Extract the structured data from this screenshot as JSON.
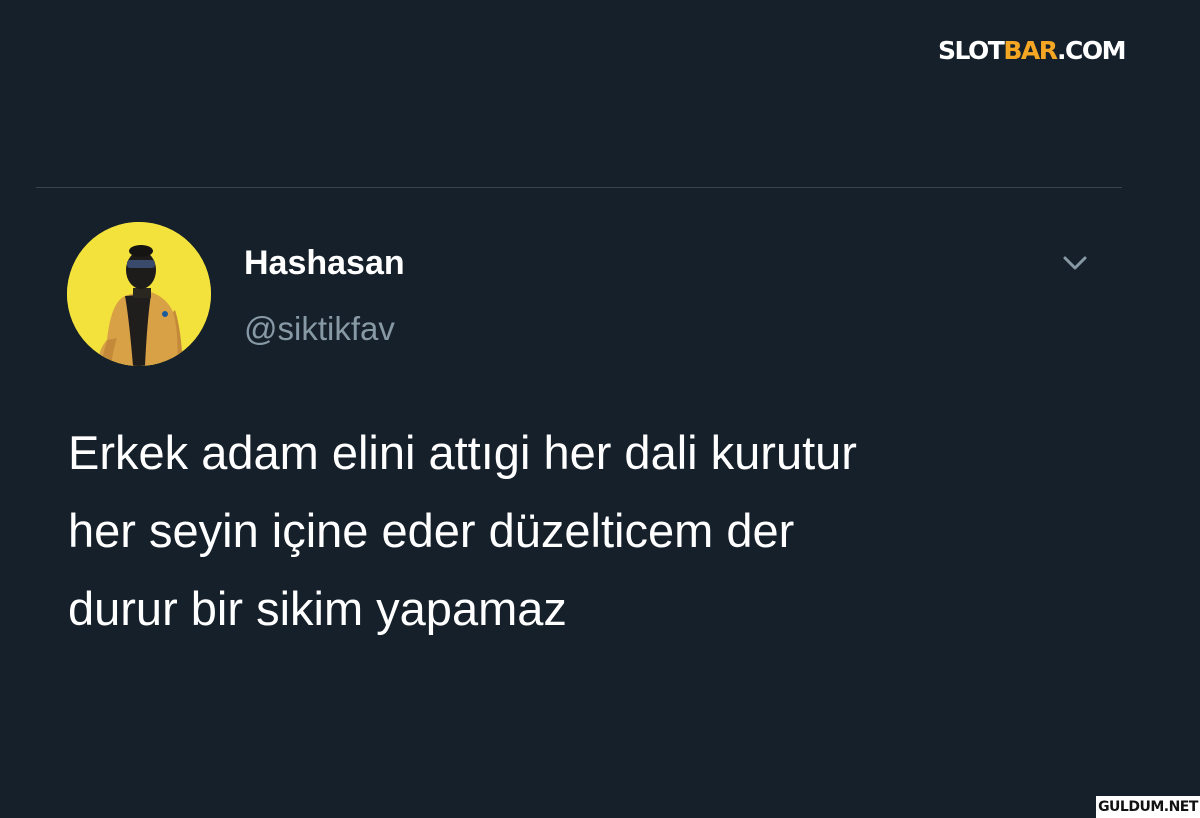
{
  "watermark_top": {
    "part1": "SLOT",
    "part2": "BAR",
    "part3": ".COM",
    "accent_color": "#f5a623"
  },
  "tweet": {
    "author": {
      "display_name": "Hashasan",
      "handle": "@siktikfav",
      "avatar_icon": "avatar-person-yellow-jacket",
      "avatar_bg": "#f5e23a"
    },
    "menu_icon": "chevron-down-icon",
    "text_lines": [
      "Erkek adam elini attıgi her dali kurutur",
      "her seyin içine eder düzelticem der",
      "durur bir sikim yapamaz"
    ]
  },
  "watermark_bottom": {
    "text": "GULDUM.NET"
  },
  "colors": {
    "background": "#15202b",
    "divider": "#38444d",
    "secondary_text": "#8899a6"
  }
}
